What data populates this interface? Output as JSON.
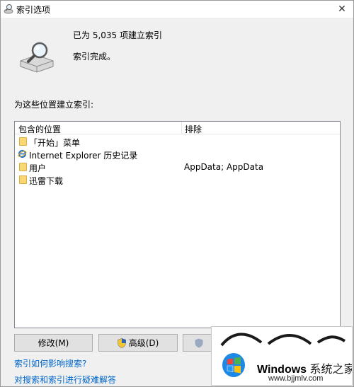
{
  "window": {
    "title": "索引选项",
    "close_glyph": "✕"
  },
  "status": {
    "indexed_count": "已为 5,035 项建立索引",
    "state": "索引完成。"
  },
  "locations_label": "为这些位置建立索引:",
  "table": {
    "columns": [
      "包含的位置",
      "排除"
    ],
    "rows": [
      {
        "icon": "folder-icon",
        "name": "「开始」菜单",
        "exclude": ""
      },
      {
        "icon": "internet-explorer-icon",
        "name": "Internet Explorer 历史记录",
        "exclude": ""
      },
      {
        "icon": "folder-icon",
        "name": "用户",
        "exclude": "AppData; AppData"
      },
      {
        "icon": "folder-icon",
        "name": "迅雷下载",
        "exclude": ""
      }
    ]
  },
  "buttons": {
    "modify": "修改(M)",
    "advanced": "高级(D)"
  },
  "links": {
    "how_affects": "索引如何影响搜索?",
    "troubleshoot": "对搜索和索引进行疑难解答"
  },
  "watermark": {
    "brand": "Windows",
    "suffix": " 系统之家",
    "url": "www.bjjmlv.com"
  },
  "colors": {
    "link": "#0066cc",
    "folder": "#f8d775",
    "window_bg": "#f0f0f0"
  }
}
